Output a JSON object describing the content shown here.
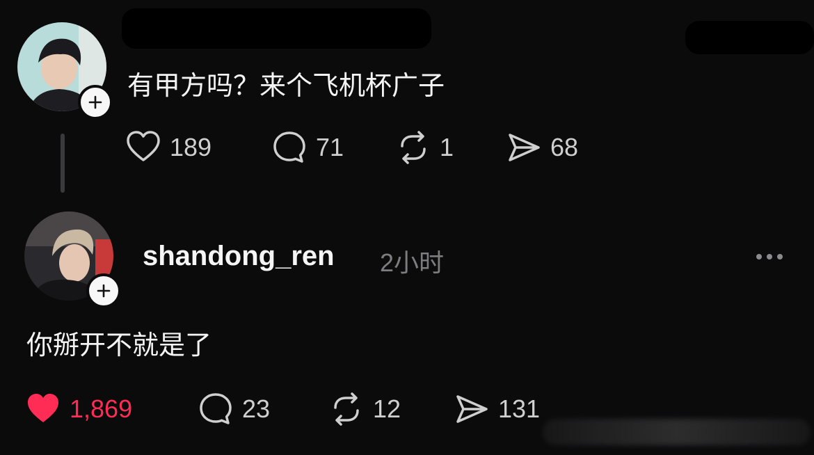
{
  "post1": {
    "text": "有甲方吗？来个飞机杯广子",
    "actions": {
      "likes": "189",
      "comments": "71",
      "reposts": "1",
      "shares": "68"
    }
  },
  "post2": {
    "username": "shandong_ren",
    "time": "2小时",
    "text": "你掰开不就是了",
    "actions": {
      "likes": "1,869",
      "comments": "23",
      "reposts": "12",
      "shares": "131"
    },
    "liked": true
  },
  "colors": {
    "background": "#0b0b0c",
    "liked": "#ff2d55",
    "muted": "#7d7d80"
  },
  "icons": [
    "heart-icon",
    "comment-icon",
    "repost-icon",
    "share-icon",
    "plus-icon",
    "more-icon"
  ]
}
